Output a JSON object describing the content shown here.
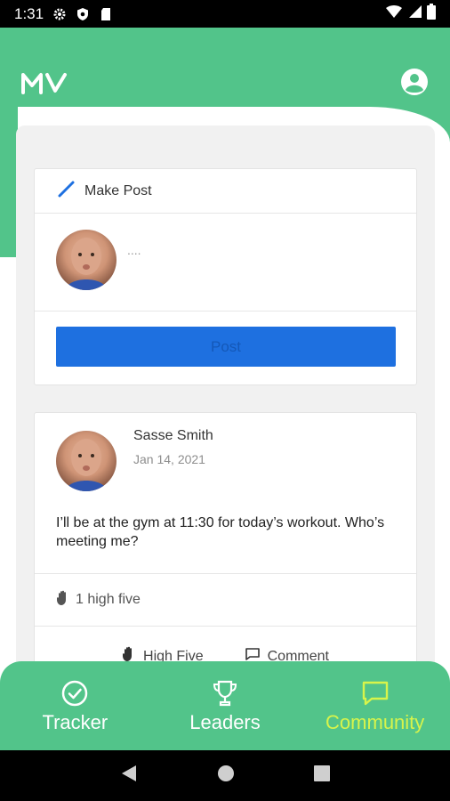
{
  "status_bar": {
    "time": "1:31"
  },
  "header": {
    "logo_text": "MV"
  },
  "make_post": {
    "title": "Make Post",
    "placeholder": "....",
    "post_button": "Post"
  },
  "feed": [
    {
      "author": "Sasse Smith",
      "date": "Jan 14, 2021",
      "content": "I’ll be at the gym at 11:30 for today’s workout. Who’s meeting me?",
      "high_fives": "1 high five",
      "actions": {
        "high_five": "High Five",
        "comment": "Comment"
      }
    }
  ],
  "bottom_nav": {
    "items": [
      {
        "label": "Tracker",
        "icon": "check-circle-icon"
      },
      {
        "label": "Leaders",
        "icon": "trophy-icon"
      },
      {
        "label": "Community",
        "icon": "chat-bubble-icon",
        "active": true
      }
    ]
  },
  "colors": {
    "brand_green": "#52c48a",
    "active_nav": "#d7f44b",
    "post_button": "#1e70e0",
    "pencil": "#1e70e0"
  }
}
